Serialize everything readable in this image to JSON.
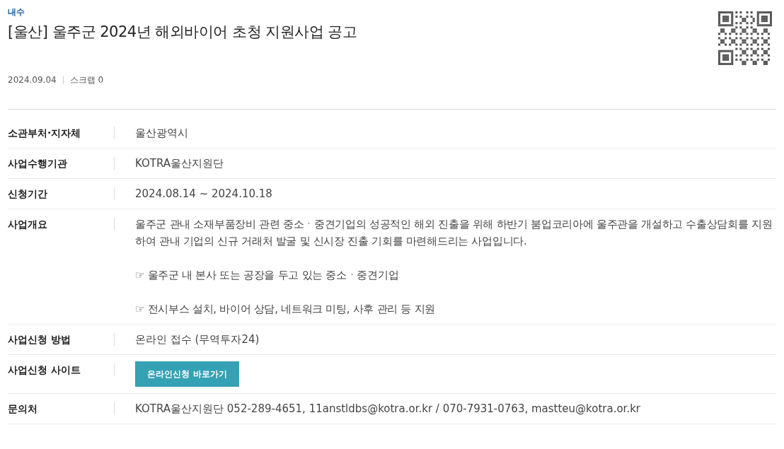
{
  "category": "내수",
  "title": "[울산] 울주군 2024년 해외바이어 초청 지원사업 공고",
  "meta": {
    "date": "2024.09.04",
    "scrap": "스크랩 0"
  },
  "rows": [
    {
      "kind": "text",
      "label": "소관부처·지자체",
      "value": "울산광역시"
    },
    {
      "kind": "text",
      "label": "사업수행기관",
      "value": "KOTRA울산지원단"
    },
    {
      "kind": "text",
      "label": "신청기간",
      "value": "2024.08.14 ~ 2024.10.18"
    },
    {
      "kind": "paragraphs",
      "label": "사업개요",
      "paragraphs": [
        "울주군 관내 소재부품장비 관련 중소ㆍ중견기업의 성공적인 해외 진출을 위해 하반기 붐업코리아에 울주관을 개설하고 수출상담회를 지원하여 관내 기업의 신규 거래처 발굴 및 신시장 진출 기회를 마련해드리는 사업입니다.",
        "☞ 울주군 내 본사 또는 공장을 두고 있는 중소ㆍ중견기업",
        "☞ 전시부스 설치, 바이어 상담, 네트워크 미팅, 사후 관리 등 지원"
      ]
    },
    {
      "kind": "text",
      "label": "사업신청 방법",
      "value": "온라인 접수 (무역투자24)"
    },
    {
      "kind": "button",
      "label": "사업신청 사이트",
      "value": "온라인신청 바로가기"
    },
    {
      "kind": "text",
      "label": "문의처",
      "value": "KOTRA울산지원단 052-289-4651, 11anstldbs@kotra.or.kr / 070-7931-0763, mastteu@kotra.or.kr"
    }
  ]
}
